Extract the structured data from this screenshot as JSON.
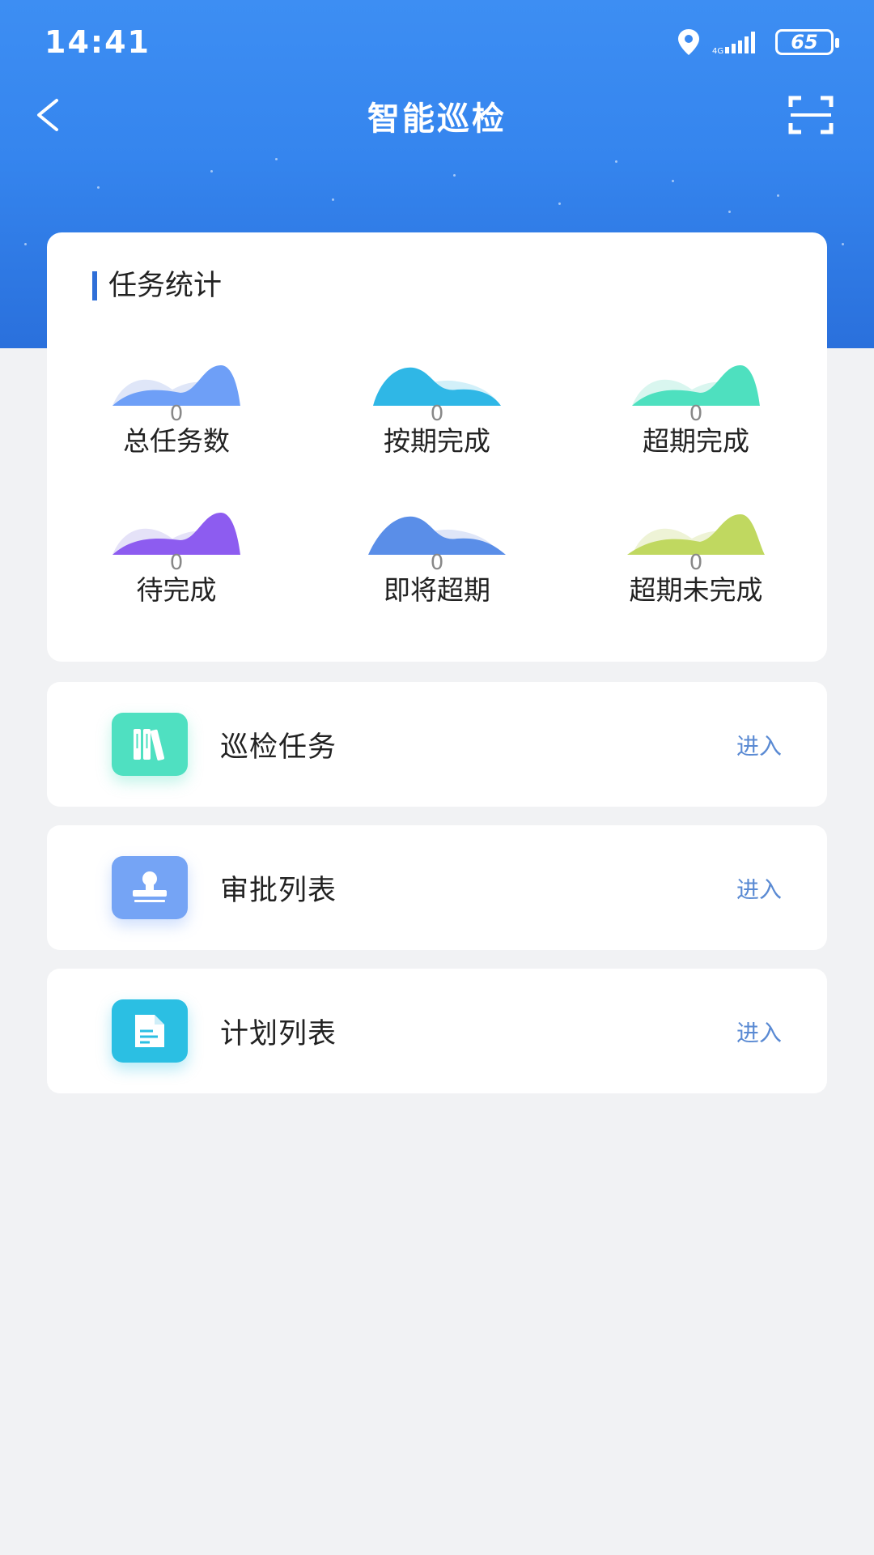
{
  "status_bar": {
    "time": "14:41",
    "battery": "65"
  },
  "nav": {
    "title": "智能巡检",
    "back_icon": "chevron-left-icon",
    "scan_icon": "scan-icon"
  },
  "stats": {
    "title": "任务统计",
    "items": [
      {
        "label": "总任务数",
        "value": "0",
        "color": "#6e9ff7"
      },
      {
        "label": "按期完成",
        "value": "0",
        "color": "#2fb7e6"
      },
      {
        "label": "超期完成",
        "value": "0",
        "color": "#4ee0bf"
      },
      {
        "label": "待完成",
        "value": "0",
        "color": "#8d5cf0"
      },
      {
        "label": "即将超期",
        "value": "0",
        "color": "#5a8ee8"
      },
      {
        "label": "超期未完成",
        "value": "0",
        "color": "#c0d860"
      }
    ]
  },
  "menu": [
    {
      "label": "巡检任务",
      "enter": "进入",
      "icon": "books-icon",
      "color": "#4fe0c1"
    },
    {
      "label": "审批列表",
      "enter": "进入",
      "icon": "stamp-icon",
      "color": "#75a4f5"
    },
    {
      "label": "计划列表",
      "enter": "进入",
      "icon": "document-icon",
      "color": "#2bbfe3"
    }
  ]
}
